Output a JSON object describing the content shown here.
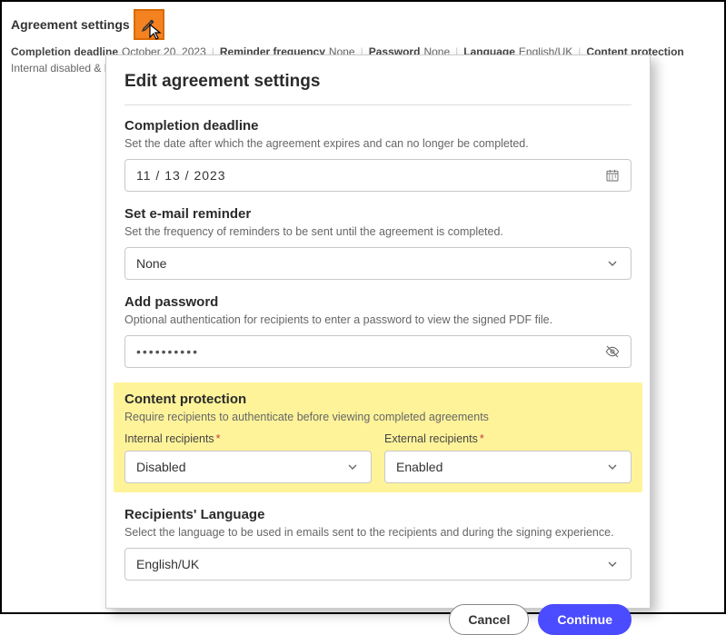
{
  "topbar": {
    "title": "Agreement settings"
  },
  "summary": {
    "deadline_label": "Completion deadline",
    "deadline_value": "October 20, 2023",
    "reminder_label": "Reminder frequency",
    "reminder_value": "None",
    "password_label": "Password",
    "password_value": "None",
    "language_label": "Language",
    "language_value": "English/UK",
    "protection_label": "Content protection",
    "protection_value": "Internal disabled & External enabled"
  },
  "modal": {
    "title": "Edit agreement settings",
    "deadline": {
      "title": "Completion deadline",
      "desc": "Set the date after which the agreement expires and can no longer be completed.",
      "value": "11 /  13 /  2023"
    },
    "reminder": {
      "title": "Set e-mail reminder",
      "desc": "Set the frequency of reminders to be sent until the agreement is completed.",
      "value": "None"
    },
    "password": {
      "title": "Add password",
      "desc": "Optional authentication for recipients to enter a password to view the signed PDF file.",
      "value": "••••••••••"
    },
    "protection": {
      "title": "Content protection",
      "desc": "Require recipients to authenticate before viewing completed agreements",
      "internal_label": "Internal recipients",
      "internal_value": "Disabled",
      "external_label": "External recipients",
      "external_value": "Enabled"
    },
    "language": {
      "title": "Recipients' Language",
      "desc": "Select the language to be used in emails sent to the recipients and during the signing experience.",
      "value": "English/UK"
    },
    "cancel": "Cancel",
    "continue": "Continue"
  }
}
